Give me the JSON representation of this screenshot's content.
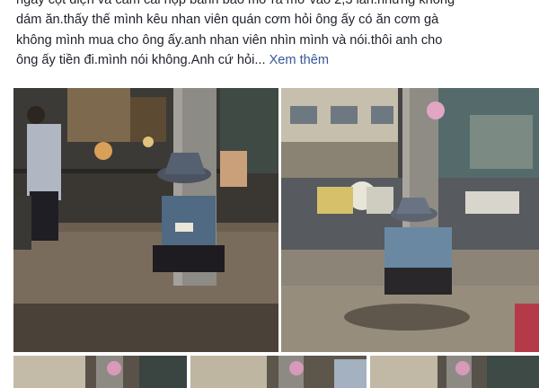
{
  "post": {
    "lines": [
      "ngay cột điện và cầm cái hộp bánh bao mở ra mở vào 2,3 lần.nhưng không",
      "dám ăn.thấy thế mình kêu nhan viên quán cơm hỏi ông ấy có ăn cơm gà",
      "không mình mua cho ông ấy.anh nhan viên nhìn mình và nói.thôi anh cho",
      "ông ấy tiền đi.mình nói không.Anh cứ hỏi... "
    ],
    "see_more": "Xem thêm",
    "link_color": "#365899",
    "text_color": "#1d2129"
  },
  "photos": {
    "main_left": {
      "icon": "photo-man-sitting-by-pole-left"
    },
    "main_right": {
      "icon": "photo-man-sitting-by-pole-right"
    },
    "thumbnails": [
      {
        "icon": "photo-thumbnail-1"
      },
      {
        "icon": "photo-thumbnail-2"
      },
      {
        "icon": "photo-thumbnail-3"
      }
    ]
  }
}
